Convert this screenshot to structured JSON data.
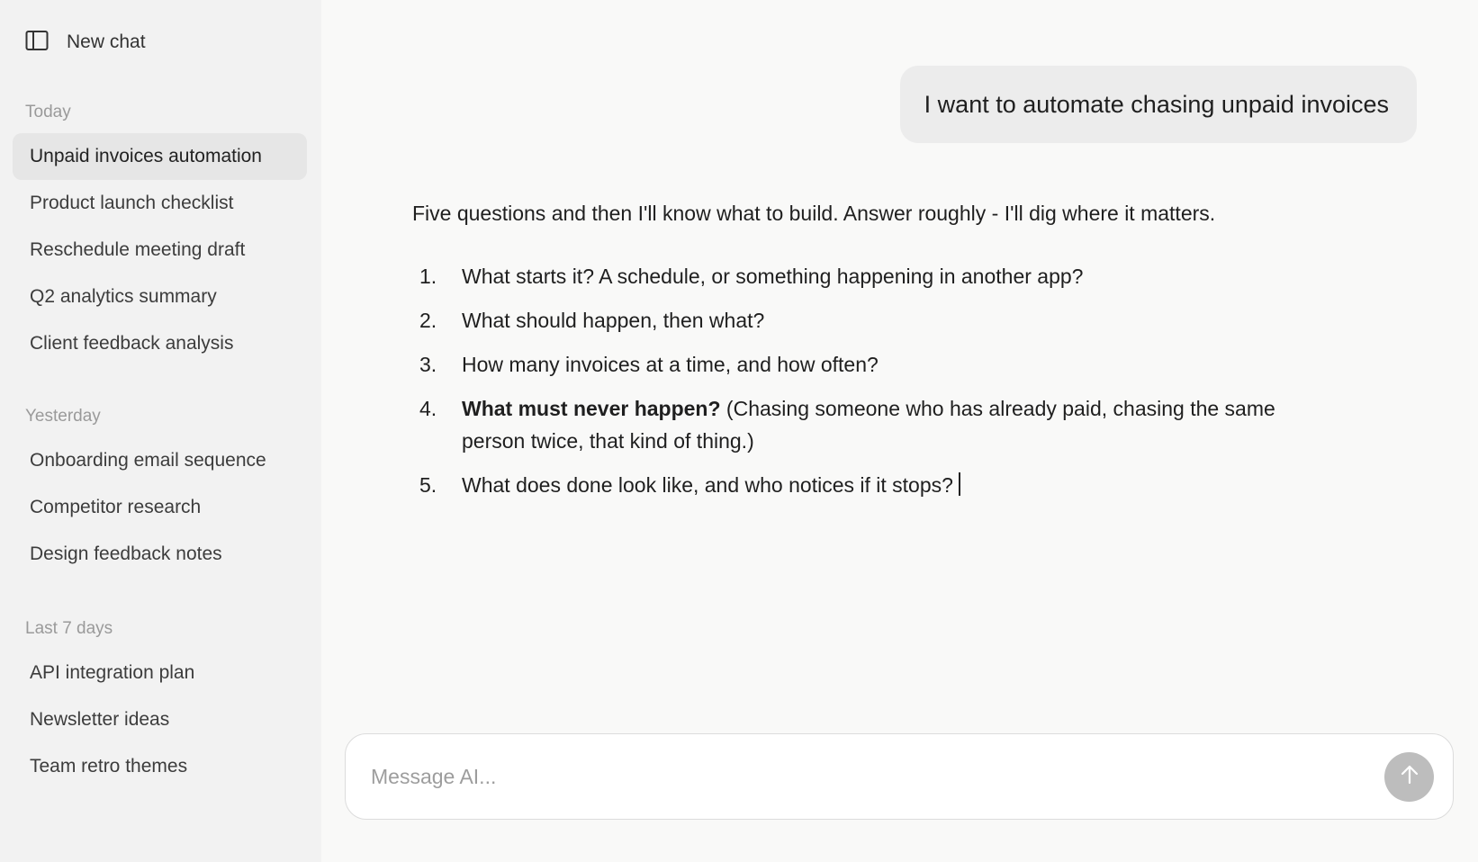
{
  "sidebar": {
    "new_chat_label": "New chat",
    "sections": [
      {
        "heading": "Today",
        "items": [
          {
            "label": "Unpaid invoices automation",
            "active": true
          },
          {
            "label": "Product launch checklist"
          },
          {
            "label": "Reschedule meeting draft"
          },
          {
            "label": "Q2 analytics summary"
          },
          {
            "label": "Client feedback analysis"
          }
        ]
      },
      {
        "heading": "Yesterday",
        "items": [
          {
            "label": "Onboarding email sequence"
          },
          {
            "label": "Competitor research"
          },
          {
            "label": "Design feedback notes"
          }
        ]
      },
      {
        "heading": "Last 7 days",
        "items": [
          {
            "label": "API integration plan"
          },
          {
            "label": "Newsletter ideas"
          },
          {
            "label": "Team retro themes"
          }
        ]
      }
    ]
  },
  "conversation": {
    "user_message": "I want to automate chasing unpaid invoices",
    "assistant_intro": "Five questions and then I'll know what to build. Answer roughly - I'll dig where it matters.",
    "questions": [
      {
        "number": "1.",
        "bold": "",
        "text": "What starts it? A schedule, or something happening in another app?"
      },
      {
        "number": "2.",
        "bold": "",
        "text": "What should happen, then what?"
      },
      {
        "number": "3.",
        "bold": "",
        "text": "How many invoices at a time, and how often?"
      },
      {
        "number": "4.",
        "bold": "What must never happen?",
        "text": " (Chasing someone who has already paid, chasing the same person twice, that kind of thing.)"
      },
      {
        "number": "5.",
        "bold": "",
        "text": "What does done look like, and who notices if it stops?"
      }
    ]
  },
  "composer": {
    "placeholder": "Message AI...",
    "value": ""
  },
  "icons": {
    "sidebar_toggle": "sidebar-toggle-icon",
    "send": "arrow-up-icon"
  },
  "colors": {
    "sidebar_bg": "#f2f2f2",
    "main_bg": "#f9f9f8",
    "active_item_bg": "#e6e6e6",
    "user_bubble_bg": "#ececec",
    "send_button_bg": "#bdbdbd"
  }
}
